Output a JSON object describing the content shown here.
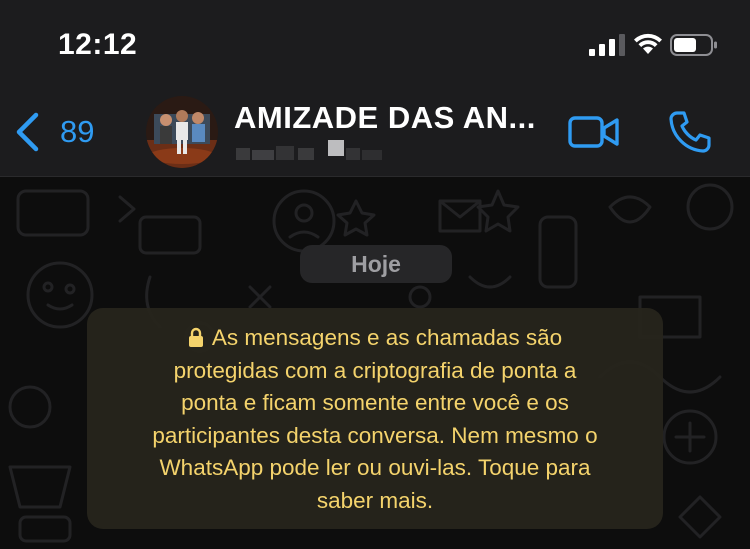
{
  "status_bar": {
    "time": "12:12",
    "signal_icon": "cellular-signal-icon",
    "wifi_icon": "wifi-icon",
    "battery_icon": "battery-icon"
  },
  "header": {
    "back_count": "89",
    "back_icon": "chevron-left-icon",
    "title": "AMIZADE DAS AN...",
    "video_icon": "video-camera-icon",
    "call_icon": "phone-icon",
    "accent": "#2f9bf2"
  },
  "chat": {
    "date_label": "Hoje",
    "encryption_notice": {
      "lines": [
        "As mensagens e as chamadas são",
        "protegidas com a criptografia de ponta a",
        "ponta e ficam somente entre você e os",
        "participantes desta conversa. Nem mesmo o",
        "WhatsApp pode ler ou ouvi-las. Toque para",
        "saber mais."
      ],
      "icon": "lock-icon",
      "color": "#f4d36c"
    }
  }
}
